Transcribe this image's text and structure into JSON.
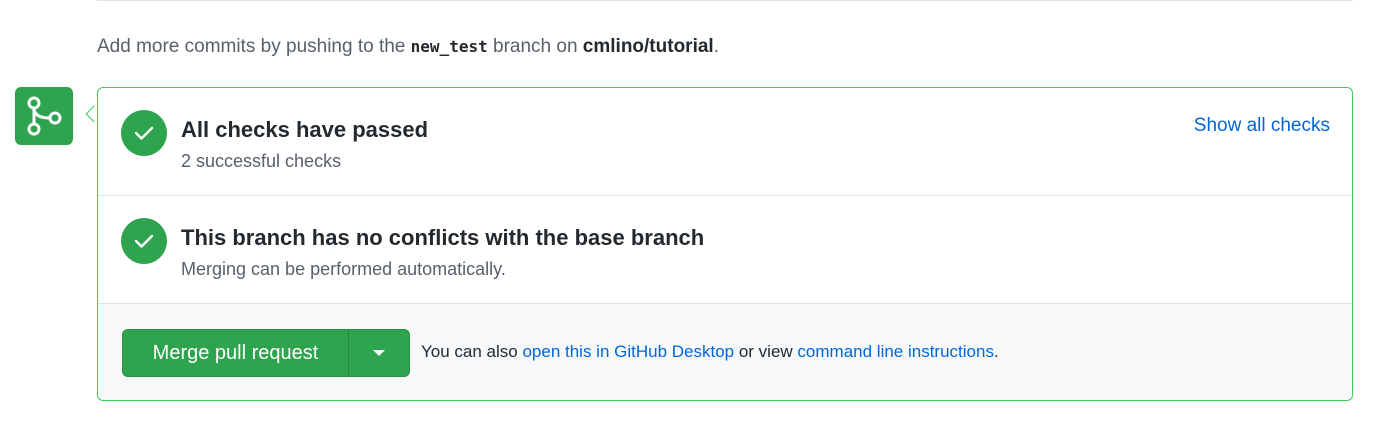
{
  "hint": {
    "prefix": "Add more commits by pushing to the ",
    "branch": "new_test",
    "middle": " branch on ",
    "repo": "cmlino/tutorial",
    "suffix": "."
  },
  "merge_icon": {
    "icon": "git-merge-icon",
    "color": "#2ea44f"
  },
  "checks": {
    "title": "All checks have passed",
    "subtitle": "2 successful checks",
    "link": "Show all checks",
    "icon": "check-icon"
  },
  "conflicts": {
    "title": "This branch has no conflicts with the base branch",
    "subtitle": "Merging can be performed automatically.",
    "icon": "check-icon"
  },
  "merge": {
    "button_label": "Merge pull request",
    "caret_icon": "caret-down-icon",
    "note_prefix": "You can also ",
    "desktop_link": "open this in GitHub Desktop",
    "note_middle": " or view ",
    "cli_link": "command line instructions",
    "note_suffix": "."
  },
  "colors": {
    "success": "#2ea44f",
    "border_success": "#34d058",
    "link": "#0366d6",
    "muted_text": "#586069"
  }
}
